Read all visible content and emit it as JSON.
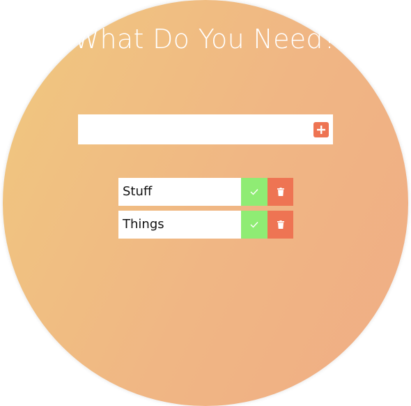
{
  "header": {
    "title": "What Do You Need?"
  },
  "add_form": {
    "input_value": "",
    "input_placeholder": "",
    "add_button_icon": "plus-icon"
  },
  "todos": [
    {
      "text": "Stuff",
      "done_icon": "check-icon",
      "delete_icon": "trash-icon"
    },
    {
      "text": "Things",
      "done_icon": "check-icon",
      "delete_icon": "trash-icon"
    }
  ],
  "colors": {
    "gradient_start": "#f0c87f",
    "gradient_end": "#f0ad85",
    "accent_orange": "#ee7453",
    "accent_green": "#8fec74",
    "surface": "#ffffff"
  }
}
